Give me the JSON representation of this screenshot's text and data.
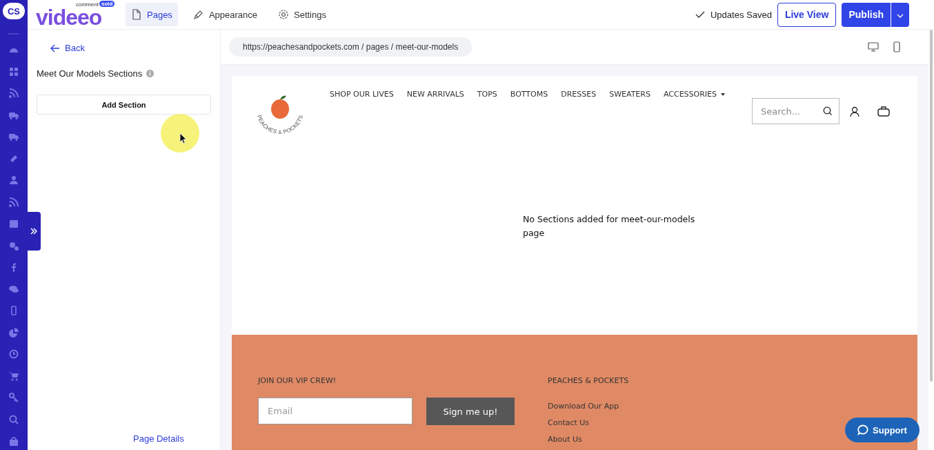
{
  "app": {
    "badge": "CS",
    "logo": {
      "word": "videeo",
      "small": "comment",
      "tag": "sold"
    }
  },
  "top_tabs": [
    {
      "label": "Pages",
      "selected": true
    },
    {
      "label": "Appearance",
      "selected": false
    },
    {
      "label": "Settings",
      "selected": false
    }
  ],
  "status": "Updates Saved",
  "buttons": {
    "live_view": "Live View",
    "publish": "Publish"
  },
  "panel": {
    "back": "Back",
    "title": "Meet Our Models Sections",
    "add_section": "Add Section",
    "page_details": "Page Details"
  },
  "address": "https://peachesandpockets.com / pages / meet-our-models",
  "store": {
    "logo_text": "PEACHES & POCKETS",
    "nav": [
      {
        "label": "SHOP OUR LIVES",
        "dropdown": false
      },
      {
        "label": "NEW ARRIVALS",
        "dropdown": false
      },
      {
        "label": "TOPS",
        "dropdown": false
      },
      {
        "label": "BOTTOMS",
        "dropdown": false
      },
      {
        "label": "DRESSES",
        "dropdown": false
      },
      {
        "label": "SWEATERS",
        "dropdown": false
      },
      {
        "label": "ACCESSORIES",
        "dropdown": true
      }
    ],
    "search_placeholder": "Search...",
    "empty_message": "No Sections added for meet-our-models page",
    "footer": {
      "vip_heading": "JOIN OUR VIP CREW!",
      "email_placeholder": "Email",
      "signup": "Sign me up!",
      "brand_heading": "PEACHES & POCKETS",
      "links": [
        "Download Our App",
        "Contact Us",
        "About Us"
      ]
    }
  },
  "support": "Support"
}
